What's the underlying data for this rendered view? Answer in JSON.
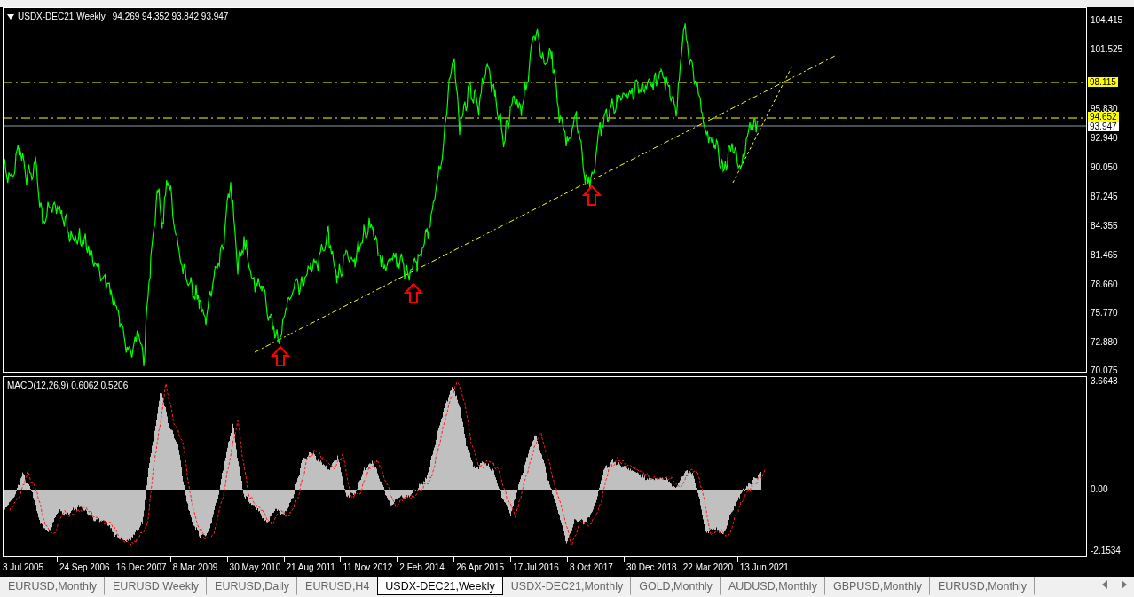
{
  "chart_header": {
    "symbol": "USDX-DEC21,Weekly",
    "ohlc": "94.269 94.352 93.842 93.947"
  },
  "price_axis": {
    "labels": [
      "104.415",
      "101.525",
      "95.830",
      "92.940",
      "90.050",
      "87.245",
      "84.355",
      "81.465",
      "78.660",
      "75.770",
      "72.880",
      "70.075"
    ]
  },
  "levels": [
    {
      "label": "98.115",
      "kind": "dashdot",
      "color": "#ffff00"
    },
    {
      "label": "94.652",
      "kind": "dashdot",
      "color": "#ffff00"
    },
    {
      "label": "93.947",
      "kind": "solid",
      "color": "#ffffff"
    }
  ],
  "indicator": {
    "title": "MACD(12,26,9) 0.6062 0.5206",
    "axis_labels": [
      "3.6643",
      "0.00",
      "-2.1534"
    ]
  },
  "time_axis": {
    "labels": [
      "3 Jul 2005",
      "24 Sep 2006",
      "16 Dec 2007",
      "8 Mar 2009",
      "30 May 2010",
      "21 Aug 2011",
      "11 Nov 2012",
      "2 Feb 2014",
      "26 Apr 2015",
      "17 Jul 2016",
      "8 Oct 2017",
      "30 Dec 2018",
      "22 Mar 2020",
      "13 Jun 2021"
    ]
  },
  "tabs": [
    {
      "label": "EURUSD,Monthly",
      "selected": false
    },
    {
      "label": "EURUSD,Weekly",
      "selected": false
    },
    {
      "label": "EURUSD,Daily",
      "selected": false
    },
    {
      "label": "EURUSD,H4",
      "selected": false
    },
    {
      "label": "USDX-DEC21,Weekly",
      "selected": true
    },
    {
      "label": "USDX-DEC21,Monthly",
      "selected": false
    },
    {
      "label": "GOLD,Monthly",
      "selected": false
    },
    {
      "label": "AUDUSD,Monthly",
      "selected": false
    },
    {
      "label": "GBPUSD,Monthly",
      "selected": false
    },
    {
      "label": "EURUSD,Monthly",
      "selected": false
    }
  ]
}
